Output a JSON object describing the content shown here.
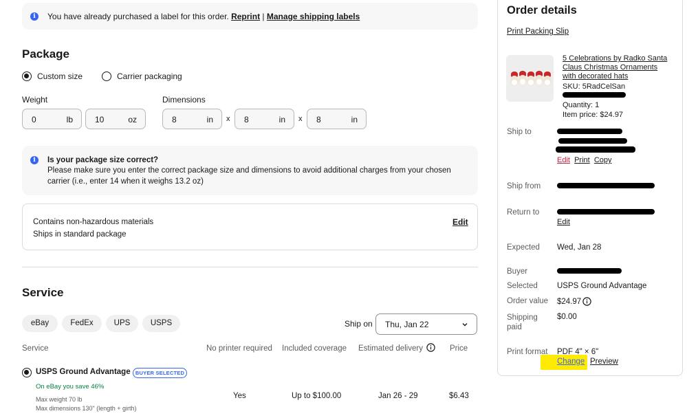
{
  "banner": {
    "message": "You have already purchased a label for this order.",
    "reprint": "Reprint",
    "separator": "|",
    "manage": "Manage shipping labels"
  },
  "package": {
    "title": "Package",
    "options": {
      "custom": "Custom size",
      "carrier": "Carrier packaging",
      "selected": "Custom size"
    },
    "weight_label": "Weight",
    "weight_lb": {
      "value": "0",
      "unit": "lb"
    },
    "weight_oz": {
      "value": "10",
      "unit": "oz"
    },
    "dimensions_label": "Dimensions",
    "dims": [
      {
        "value": "8",
        "unit": "in"
      },
      {
        "value": "8",
        "unit": "in"
      },
      {
        "value": "8",
        "unit": "in"
      }
    ],
    "times": "x",
    "notice_title": "Is your package size correct?",
    "notice_body_1": "Please make sure you enter the correct package size and dimensions to avoid additional charges from your chosen",
    "notice_body_2": "carrier (i.e., enter 14 when it weighs 13.2 oz)",
    "hazard_line1": "Contains non-hazardous materials",
    "hazard_line2": "Ships in standard package",
    "edit": "Edit"
  },
  "service": {
    "title": "Service",
    "carriers": [
      "eBay",
      "FedEx",
      "UPS",
      "USPS"
    ],
    "ship_on_label": "Ship on",
    "ship_on_value": "Thu, Jan 22",
    "columns": {
      "service": "Service",
      "printer": "No printer required",
      "coverage": "Included coverage",
      "delivery": "Estimated delivery",
      "price": "Price"
    },
    "row": {
      "name": "USPS Ground Advantage",
      "badge": "BUYER SELECTED",
      "savings": "On eBay you save 46%",
      "max_weight": "Max weight 70 lb",
      "max_dims": "Max dimensions 130\" (length + girth)",
      "printer": "Yes",
      "coverage": "Up to $100.00",
      "delivery": "Jan 26 - 29",
      "price": "$6.43"
    }
  },
  "order": {
    "title": "Order details",
    "print_packing_slip": "Print Packing Slip",
    "item_title": "5 Celebrations by Radko Santa Claus Christmas Ornaments with decorated hats",
    "sku": "SKU: 5RadCelSan",
    "quantity": "Quantity: 1",
    "item_price": "Item price: $24.97",
    "ship_to_label": "Ship to",
    "address_actions": [
      "Edit",
      "Print",
      "Copy"
    ],
    "ship_from_label": "Ship from",
    "return_to_label": "Return to",
    "return_edit": "Edit",
    "expected_label": "Expected",
    "expected_value": "Wed, Jan 28",
    "buyer_label": "Buyer",
    "selected_label": "Selected",
    "selected_value": "USPS Ground Advantage",
    "order_value_label": "Order value",
    "order_value": "$24.97",
    "shipping_paid_label": "Shipping paid",
    "shipping_paid": "$0.00",
    "print_format_label": "Print format",
    "print_format_value": "PDF 4\" × 6\"",
    "change": "Change",
    "preview": "Preview",
    "highlight_color": "#ffeb00"
  }
}
